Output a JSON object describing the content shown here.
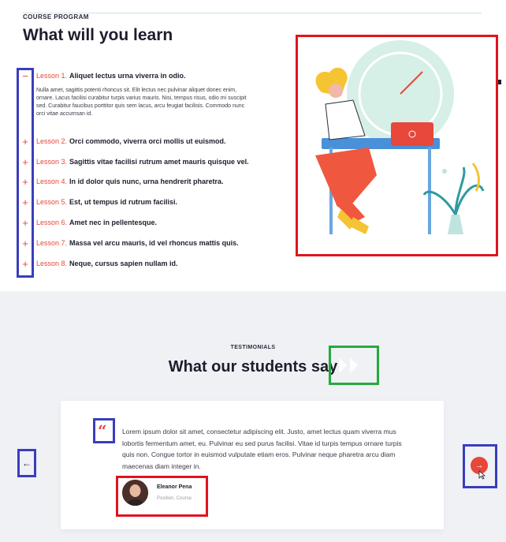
{
  "course": {
    "eyebrow": "COURSE PROGRAM",
    "heading": "What will you learn",
    "lessons": [
      {
        "num": "Lesson 1.",
        "title": "Aliquet lectus urna viverra in odio.",
        "expanded": true,
        "body": "Nulla amet, sagittis potenti rhoncus sit. Elit lectus nec pulvinar aliquet donec enim, ornare. Lacus facilisi curabitur turpis varius mauris. Nisi, tempus risus, odio mi suscipit sed. Curabitur faucibus porttitor quis sem lacus, arcu feugiat facilisis. Commodo nunc orci vitae accumsan id."
      },
      {
        "num": "Lesson 2.",
        "title": "Orci commodo, viverra orci mollis ut euismod."
      },
      {
        "num": "Lesson 3.",
        "title": "Sagittis vitae facilisi rutrum amet mauris quisque vel."
      },
      {
        "num": "Lesson 4.",
        "title": "In id dolor quis nunc, urna hendrerit pharetra."
      },
      {
        "num": "Lesson 5.",
        "title": "Est, ut tempus id rutrum facilisi."
      },
      {
        "num": "Lesson 6.",
        "title": "Amet nec in pellentesque."
      },
      {
        "num": "Lesson 7.",
        "title": "Massa vel arcu mauris, id vel rhoncus mattis quis."
      },
      {
        "num": "Lesson 8.",
        "title": "Neque, cursus sapien nullam id."
      }
    ],
    "toggle_minus": "−",
    "toggle_plus": "+"
  },
  "testimonials": {
    "eyebrow": "TESTIMONIALS",
    "heading": "What our students say",
    "quote_mark": "“",
    "quote": "Lorem ipsum dolor sit amet, consectetur adipiscing elit. Justo, amet lectus quam viverra mus lobortis fermentum amet, eu. Pulvinar eu sed purus facilisi. Vitae id turpis tempus ornare turpis quis non. Congue tortor in euismod vulputate etiam eros. Pulvinar neque pharetra arcu diam maecenas diam integer in.",
    "author_name": "Eleanor Pena",
    "author_role": "Position, Course",
    "prev_arrow": "←",
    "next_arrow": "→"
  },
  "colors": {
    "accent": "#e8473b",
    "annotation_blue": "#3a3dbd",
    "annotation_red": "#e0141e",
    "annotation_green": "#26a93f"
  }
}
